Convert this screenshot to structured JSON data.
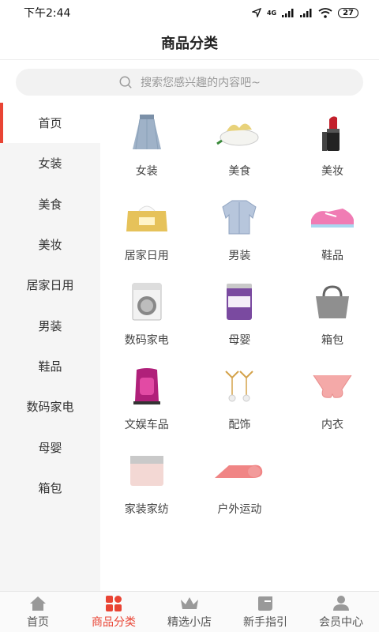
{
  "status": {
    "time": "下午2:44",
    "battery": "27",
    "network": "4G"
  },
  "header": {
    "title": "商品分类"
  },
  "search": {
    "placeholder": "搜索您感兴趣的内容吧~"
  },
  "sidebar": {
    "items": [
      {
        "label": "首页",
        "active": true
      },
      {
        "label": "女装"
      },
      {
        "label": "美食"
      },
      {
        "label": "美妆"
      },
      {
        "label": "居家日用"
      },
      {
        "label": "男装"
      },
      {
        "label": "鞋品"
      },
      {
        "label": "数码家电"
      },
      {
        "label": "母婴"
      },
      {
        "label": "箱包"
      }
    ]
  },
  "categories": [
    {
      "label": "女装",
      "icon": "skirt-icon"
    },
    {
      "label": "美食",
      "icon": "food-bowl-icon"
    },
    {
      "label": "美妆",
      "icon": "lipstick-icon"
    },
    {
      "label": "居家日用",
      "icon": "tissue-box-icon"
    },
    {
      "label": "男装",
      "icon": "shirt-icon"
    },
    {
      "label": "鞋品",
      "icon": "sneaker-icon"
    },
    {
      "label": "数码家电",
      "icon": "washing-machine-icon"
    },
    {
      "label": "母婴",
      "icon": "milk-powder-icon"
    },
    {
      "label": "箱包",
      "icon": "handbag-icon"
    },
    {
      "label": "文娱车品",
      "icon": "car-seat-icon"
    },
    {
      "label": "配饰",
      "icon": "earrings-icon"
    },
    {
      "label": "内衣",
      "icon": "bra-icon"
    },
    {
      "label": "家装家纺",
      "icon": "bedding-icon"
    },
    {
      "label": "户外运动",
      "icon": "yoga-mat-icon"
    }
  ],
  "tabbar": {
    "items": [
      {
        "label": "首页",
        "icon": "home-icon"
      },
      {
        "label": "商品分类",
        "icon": "category-icon",
        "active": true
      },
      {
        "label": "精选小店",
        "icon": "crown-icon"
      },
      {
        "label": "新手指引",
        "icon": "tag-icon"
      },
      {
        "label": "会员中心",
        "icon": "user-icon"
      }
    ]
  },
  "colors": {
    "accent": "#e94434",
    "sidebar_bg": "#f5f5f5",
    "search_bg": "#f2f2f2"
  }
}
